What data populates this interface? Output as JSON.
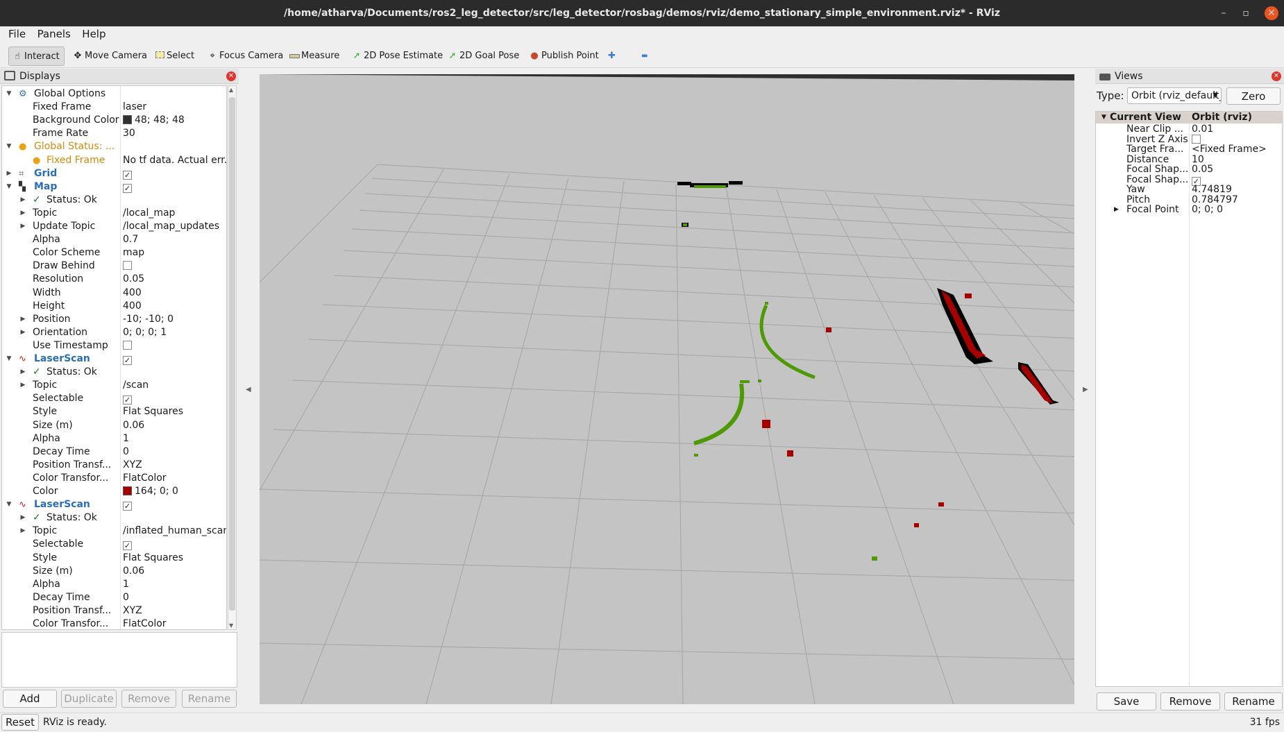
{
  "window": {
    "title": "/home/atharva/Documents/ros2_leg_detector/src/leg_detector/rosbag/demos/rviz/demo_stationary_simple_environment.rviz* - RViz",
    "min_glyph": "–",
    "max_glyph": "▫",
    "close_glyph": "✕"
  },
  "menu": [
    "File",
    "Panels",
    "Help"
  ],
  "toolbar": {
    "interact": "Interact",
    "move_camera": "Move Camera",
    "select": "Select",
    "focus_camera": "Focus Camera",
    "measure": "Measure",
    "pose_estimate": "2D Pose Estimate",
    "goal_pose": "2D Goal Pose",
    "publish_point": "Publish Point",
    "plus": "✚",
    "minus": "▬"
  },
  "displays": {
    "title": "Displays",
    "rows": [
      {
        "label": "Global Options",
        "value": ""
      },
      {
        "label": "Fixed Frame",
        "value": "laser"
      },
      {
        "label": "Background Color",
        "value": "48; 48; 48"
      },
      {
        "label": "Frame Rate",
        "value": "30"
      },
      {
        "label": "Global Status: ...",
        "value": ""
      },
      {
        "label": "Fixed Frame",
        "value": "No tf data.  Actual err..."
      },
      {
        "label": "Grid",
        "value": ""
      },
      {
        "label": "Map",
        "value": ""
      },
      {
        "label": "Status: Ok",
        "value": ""
      },
      {
        "label": "Topic",
        "value": "/local_map"
      },
      {
        "label": "Update Topic",
        "value": "/local_map_updates"
      },
      {
        "label": "Alpha",
        "value": "0.7"
      },
      {
        "label": "Color Scheme",
        "value": "map"
      },
      {
        "label": "Draw Behind",
        "value": ""
      },
      {
        "label": "Resolution",
        "value": "0.05"
      },
      {
        "label": "Width",
        "value": "400"
      },
      {
        "label": "Height",
        "value": "400"
      },
      {
        "label": "Position",
        "value": "-10; -10; 0"
      },
      {
        "label": "Orientation",
        "value": "0; 0; 0; 1"
      },
      {
        "label": "Use Timestamp",
        "value": ""
      },
      {
        "label": "LaserScan",
        "value": ""
      },
      {
        "label": "Status: Ok",
        "value": ""
      },
      {
        "label": "Topic",
        "value": "/scan"
      },
      {
        "label": "Selectable",
        "value": ""
      },
      {
        "label": "Style",
        "value": "Flat Squares"
      },
      {
        "label": "Size (m)",
        "value": "0.06"
      },
      {
        "label": "Alpha",
        "value": "1"
      },
      {
        "label": "Decay Time",
        "value": "0"
      },
      {
        "label": "Position Transf...",
        "value": "XYZ"
      },
      {
        "label": "Color Transfor...",
        "value": "FlatColor"
      },
      {
        "label": "Color",
        "value": "164; 0; 0"
      },
      {
        "label": "LaserScan",
        "value": ""
      },
      {
        "label": "Status: Ok",
        "value": ""
      },
      {
        "label": "Topic",
        "value": "/inflated_human_scan"
      },
      {
        "label": "Selectable",
        "value": ""
      },
      {
        "label": "Style",
        "value": "Flat Squares"
      },
      {
        "label": "Size (m)",
        "value": "0.06"
      },
      {
        "label": "Alpha",
        "value": "1"
      },
      {
        "label": "Decay Time",
        "value": "0"
      },
      {
        "label": "Position Transf...",
        "value": "XYZ"
      },
      {
        "label": "Color Transfor...",
        "value": "FlatColor"
      }
    ],
    "buttons": {
      "add": "Add",
      "duplicate": "Duplicate",
      "remove": "Remove",
      "rename": "Rename"
    },
    "colors": {
      "background_swatch": "#303030",
      "laser_swatch": "#a40000"
    }
  },
  "views": {
    "title": "Views",
    "type_label": "Type:",
    "type_value": "Orbit (rviz_default_plugins)",
    "zero": "Zero",
    "header": {
      "label": "Current View",
      "value": "Orbit (rviz)"
    },
    "rows": [
      {
        "label": "Near Clip ...",
        "value": "0.01"
      },
      {
        "label": "Invert Z Axis",
        "value": ""
      },
      {
        "label": "Target Fra...",
        "value": "<Fixed Frame>"
      },
      {
        "label": "Distance",
        "value": "10"
      },
      {
        "label": "Focal Shap...",
        "value": "0.05"
      },
      {
        "label": "Focal Shap...",
        "value": ""
      },
      {
        "label": "Yaw",
        "value": "4.74819"
      },
      {
        "label": "Pitch",
        "value": "0.784797"
      },
      {
        "label": "Focal Point",
        "value": "0; 0; 0"
      }
    ],
    "buttons": {
      "save": "Save",
      "remove": "Remove",
      "rename": "Rename"
    }
  },
  "status": {
    "reset": "Reset",
    "message": "RViz is ready.",
    "fps": "31 fps"
  },
  "scene_colors": {
    "grid_bg": "#c4c4c4",
    "grid_line": "#a9a9a9",
    "scan": "#a40000",
    "human": "#4e9a06",
    "map_obstacle": "#000000"
  }
}
